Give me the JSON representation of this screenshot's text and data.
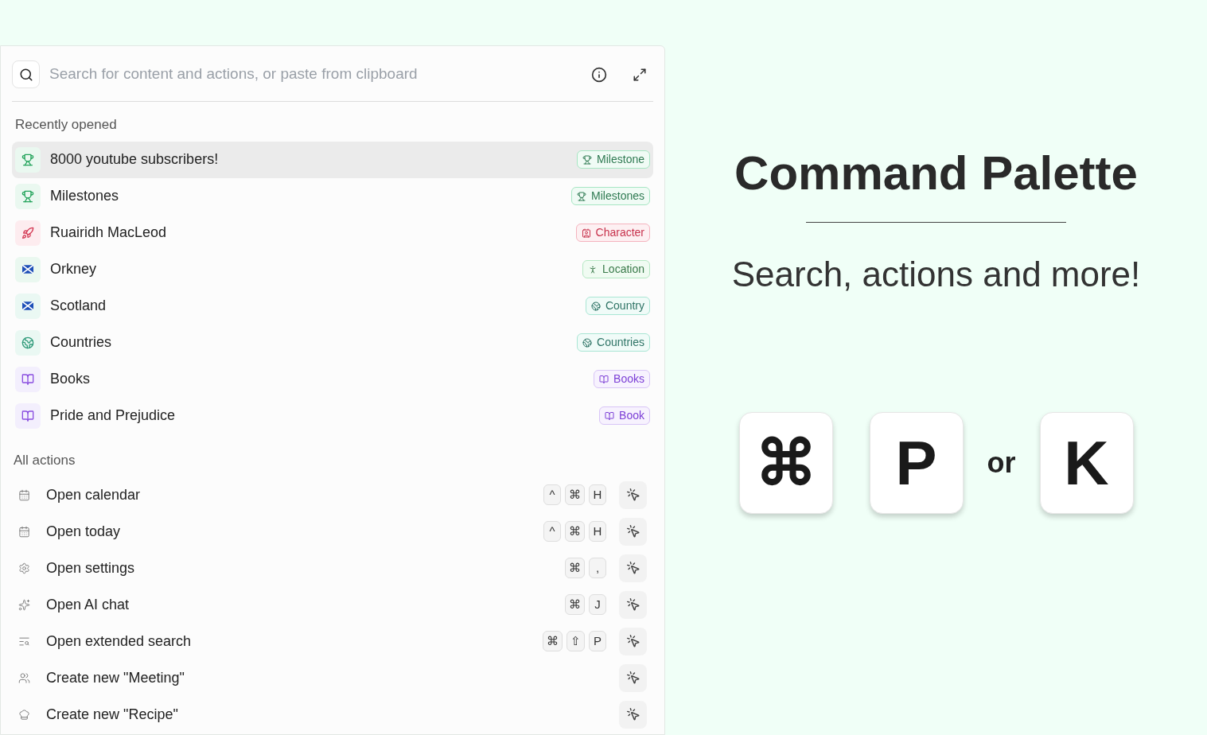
{
  "search": {
    "placeholder": "Search for content and actions, or paste from clipboard"
  },
  "recent": {
    "heading": "Recently opened",
    "items": [
      {
        "label": "8000 youtube subscribers!",
        "kind": "milestone",
        "tag": "Milestone",
        "selected": true
      },
      {
        "label": "Milestones",
        "kind": "milestone",
        "tag": "Milestones",
        "selected": false
      },
      {
        "label": "Ruairidh MacLeod",
        "kind": "character",
        "tag": "Character",
        "selected": false
      },
      {
        "label": "Orkney",
        "kind": "location",
        "tag": "Location",
        "selected": false
      },
      {
        "label": "Scotland",
        "kind": "country",
        "tag": "Country",
        "selected": false
      },
      {
        "label": "Countries",
        "kind": "countries",
        "tag": "Countries",
        "selected": false
      },
      {
        "label": "Books",
        "kind": "book",
        "tag": "Books",
        "selected": false
      },
      {
        "label": "Pride and Prejudice",
        "kind": "book",
        "tag": "Book",
        "selected": false
      }
    ]
  },
  "actions": {
    "heading": "All actions",
    "items": [
      {
        "label": "Open calendar",
        "kind": "calendar",
        "keys": [
          "^",
          "⌘",
          "H"
        ]
      },
      {
        "label": "Open today",
        "kind": "calendar",
        "keys": [
          "^",
          "⌘",
          "H"
        ]
      },
      {
        "label": "Open settings",
        "kind": "settings",
        "keys": [
          "⌘",
          ","
        ]
      },
      {
        "label": "Open AI chat",
        "kind": "ai",
        "keys": [
          "⌘",
          "J"
        ]
      },
      {
        "label": "Open extended search",
        "kind": "search",
        "keys": [
          "⌘",
          "⇧",
          "P"
        ]
      },
      {
        "label": "Create new \"Meeting\"",
        "kind": "meeting"
      },
      {
        "label": "Create new \"Recipe\"",
        "kind": "recipe"
      }
    ]
  },
  "promo": {
    "title": "Command Palette",
    "subtitle": "Search, actions and more!",
    "keys": [
      {
        "kind": "key",
        "label": "⌘"
      },
      {
        "kind": "key",
        "label": "P"
      },
      {
        "kind": "word",
        "label": "or"
      },
      {
        "kind": "key",
        "label": "K"
      }
    ]
  }
}
